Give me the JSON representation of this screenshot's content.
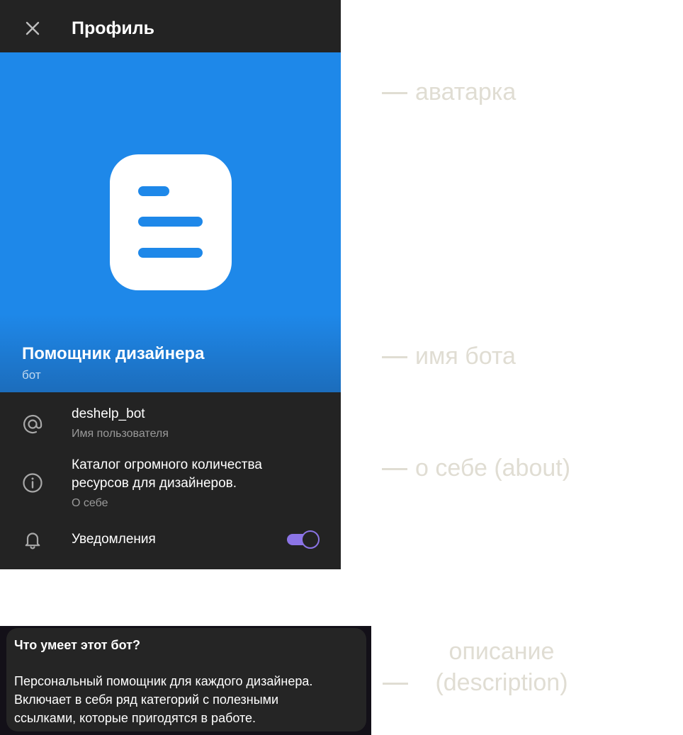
{
  "topbar": {
    "title": "Профиль",
    "close_icon": "close-icon"
  },
  "profile": {
    "bot_name": "Помощник дизайнера",
    "bot_type": "бот",
    "avatar_color": "#1e88e9"
  },
  "rows": {
    "username": {
      "icon": "at-icon",
      "value": "deshelp_bot",
      "label": "Имя пользователя"
    },
    "about": {
      "icon": "info-icon",
      "line1": "Каталог огромного количества",
      "line2": "ресурсов для дизайнеров.",
      "label": "О себе"
    },
    "notifications": {
      "icon": "bell-icon",
      "label": "Уведомления",
      "enabled": true,
      "accent": "#8b74e6"
    }
  },
  "description": {
    "title": "Что умеет этот бот?",
    "line1": "Персональный помощник для каждого дизайнера.",
    "line2": "Включает в себя ряд категорий с полезными",
    "line3": "ссылками, которые пригодятся в работе."
  },
  "annotations": {
    "avatar": "аватарка",
    "name": "имя бота",
    "about": "о себе (about)",
    "description_line1": "описание",
    "description_line2": "(description)"
  }
}
